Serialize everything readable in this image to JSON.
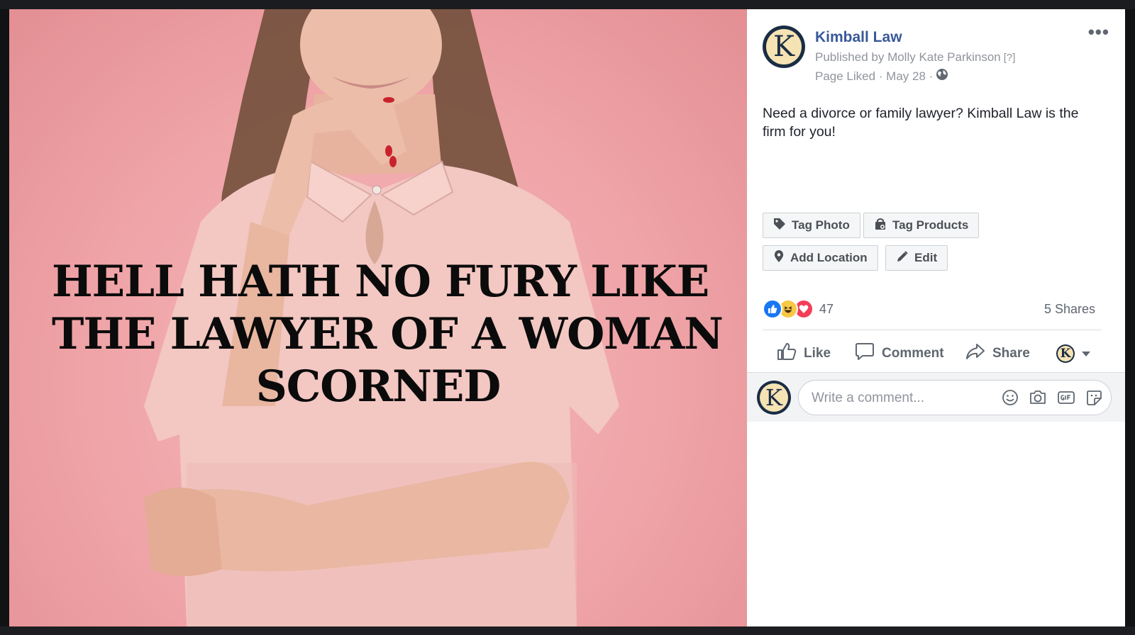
{
  "photo": {
    "headline_lines": [
      "HELL HATH NO FURY LIKE",
      "THE LAWYER OF A WOMAN",
      "SCORNED"
    ]
  },
  "post": {
    "avatar_letter": "K",
    "page_name": "Kimball Law",
    "published_by": "Published by Molly Kate Parkinson",
    "published_help": "[?]",
    "meta": "Page Liked · May 28 ·",
    "more_label": "•••",
    "caption": "Need a divorce or family lawyer? Kimball Law is the firm for you!",
    "actions": {
      "tag_photo": "Tag Photo",
      "tag_products": "Tag Products",
      "add_location": "Add Location",
      "edit": "Edit"
    },
    "reaction_count": "47",
    "shares": "5 Shares",
    "bar": {
      "like": "Like",
      "comment": "Comment",
      "share": "Share"
    },
    "comment_placeholder": "Write a comment..."
  },
  "colors": {
    "brand_blue": "#385898",
    "like_blue": "#1877f2",
    "love_red": "#f33e58",
    "haha_yellow": "#f7c844",
    "photo_pink": "#f2aaad",
    "logo_navy": "#1a2d44",
    "logo_cream": "#f6e3b4"
  },
  "icons": [
    "globe-icon",
    "tag-icon",
    "shopping-bag-icon",
    "location-pin-icon",
    "pencil-icon",
    "like-reaction-icon",
    "haha-reaction-icon",
    "love-reaction-icon",
    "thumbs-up-icon",
    "comment-icon",
    "share-icon",
    "caret-down-icon",
    "emoji-icon",
    "camera-icon",
    "gif-icon",
    "sticker-icon"
  ]
}
